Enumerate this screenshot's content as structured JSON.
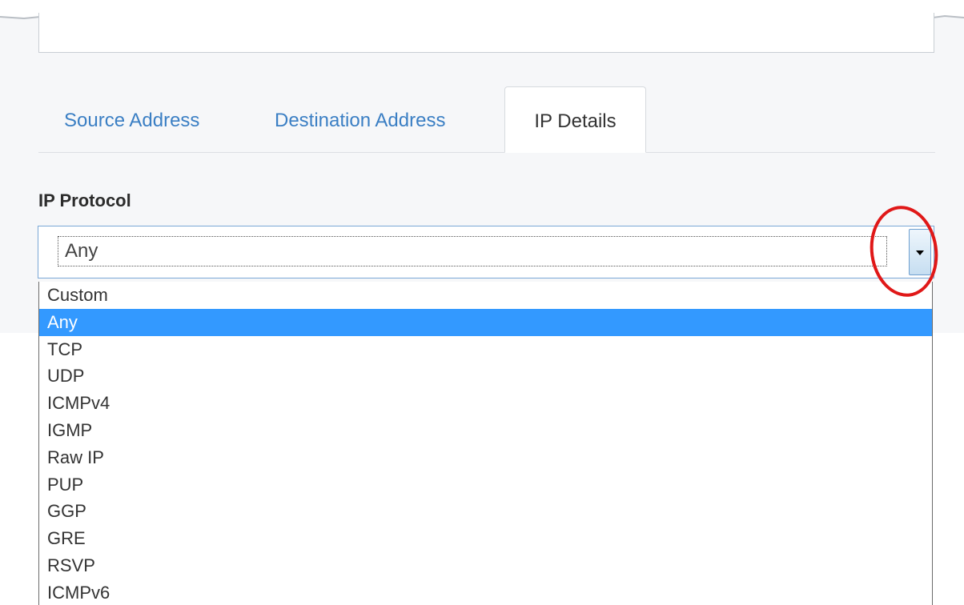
{
  "tabs": [
    {
      "label": "Source Address",
      "active": false
    },
    {
      "label": "Destination Address",
      "active": false
    },
    {
      "label": "IP Details",
      "active": true
    }
  ],
  "ip_protocol": {
    "label": "IP Protocol",
    "selected_value": "Any",
    "options": [
      "Custom",
      "Any",
      "TCP",
      "UDP",
      "ICMPv4",
      "IGMP",
      "Raw IP",
      "PUP",
      "GGP",
      "GRE",
      "RSVP",
      "ICMPv6"
    ],
    "selected_index": 1
  },
  "icons": {
    "dropdown_arrow": "chevron-down-icon"
  },
  "colors": {
    "tab_link": "#3b7fc4",
    "selected_option_bg": "#3399ff",
    "annotation_circle": "#e01818"
  }
}
